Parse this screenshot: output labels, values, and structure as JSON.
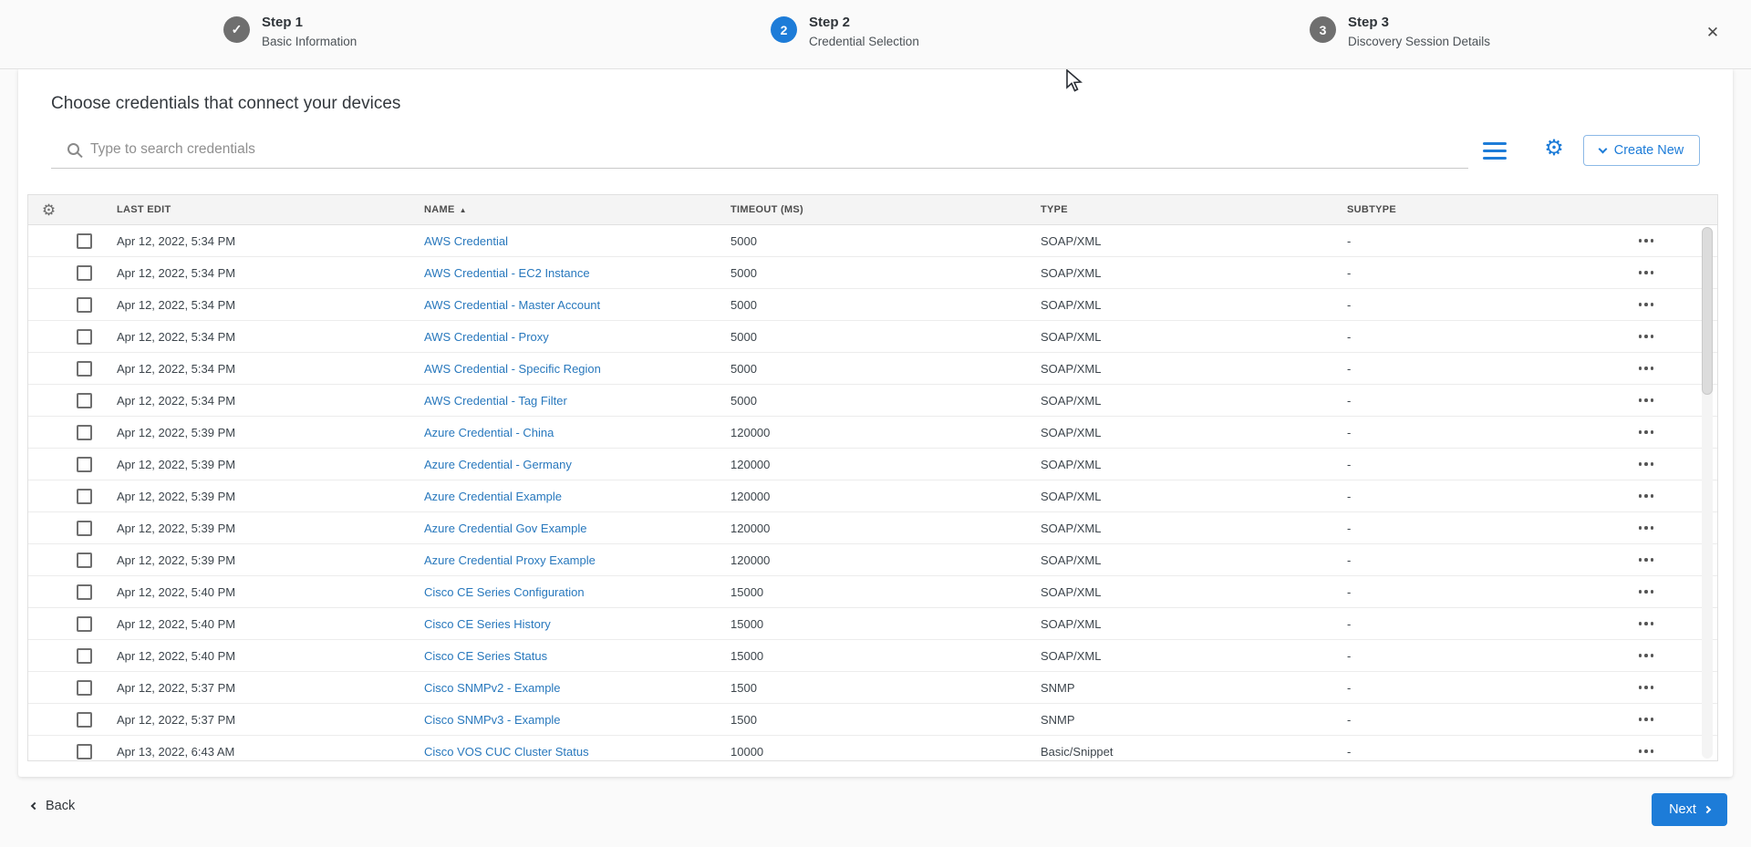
{
  "colors": {
    "accent_blue": "#1d7cd8",
    "link_blue": "#2878bd",
    "step_gray": "#6f6f6f"
  },
  "stepper": {
    "steps": [
      {
        "label": "Step 1",
        "sublabel": "Basic Information",
        "status": "complete",
        "marker": "✓"
      },
      {
        "label": "Step 2",
        "sublabel": "Credential Selection",
        "status": "active",
        "marker": "2"
      },
      {
        "label": "Step 3",
        "sublabel": "Discovery Session Details",
        "status": "upcoming",
        "marker": "3"
      }
    ],
    "close_icon": "✕"
  },
  "main": {
    "title": "Choose credentials that connect your devices",
    "search": {
      "placeholder": "Type to search credentials",
      "value": ""
    },
    "toolbar": {
      "gear_icon": "⚙",
      "create_new_label": "Create New"
    }
  },
  "table": {
    "header": {
      "gear_icon": "⚙",
      "last_edit": "LAST EDIT",
      "name": "NAME",
      "sort_arrow": "▲",
      "timeout": "TIMEOUT (MS)",
      "type": "TYPE",
      "subtype": "SUBTYPE"
    },
    "sort": {
      "column": "NAME",
      "direction": "asc"
    },
    "rows": [
      {
        "last_edit": "Apr 12, 2022, 5:34 PM",
        "name": "AWS Credential",
        "timeout": "5000",
        "type": "SOAP/XML",
        "subtype": "-"
      },
      {
        "last_edit": "Apr 12, 2022, 5:34 PM",
        "name": "AWS Credential - EC2 Instance",
        "timeout": "5000",
        "type": "SOAP/XML",
        "subtype": "-"
      },
      {
        "last_edit": "Apr 12, 2022, 5:34 PM",
        "name": "AWS Credential - Master Account",
        "timeout": "5000",
        "type": "SOAP/XML",
        "subtype": "-"
      },
      {
        "last_edit": "Apr 12, 2022, 5:34 PM",
        "name": "AWS Credential - Proxy",
        "timeout": "5000",
        "type": "SOAP/XML",
        "subtype": "-"
      },
      {
        "last_edit": "Apr 12, 2022, 5:34 PM",
        "name": "AWS Credential - Specific Region",
        "timeout": "5000",
        "type": "SOAP/XML",
        "subtype": "-"
      },
      {
        "last_edit": "Apr 12, 2022, 5:34 PM",
        "name": "AWS Credential - Tag Filter",
        "timeout": "5000",
        "type": "SOAP/XML",
        "subtype": "-"
      },
      {
        "last_edit": "Apr 12, 2022, 5:39 PM",
        "name": "Azure Credential - China",
        "timeout": "120000",
        "type": "SOAP/XML",
        "subtype": "-"
      },
      {
        "last_edit": "Apr 12, 2022, 5:39 PM",
        "name": "Azure Credential - Germany",
        "timeout": "120000",
        "type": "SOAP/XML",
        "subtype": "-"
      },
      {
        "last_edit": "Apr 12, 2022, 5:39 PM",
        "name": "Azure Credential Example",
        "timeout": "120000",
        "type": "SOAP/XML",
        "subtype": "-"
      },
      {
        "last_edit": "Apr 12, 2022, 5:39 PM",
        "name": "Azure Credential Gov Example",
        "timeout": "120000",
        "type": "SOAP/XML",
        "subtype": "-"
      },
      {
        "last_edit": "Apr 12, 2022, 5:39 PM",
        "name": "Azure Credential Proxy Example",
        "timeout": "120000",
        "type": "SOAP/XML",
        "subtype": "-"
      },
      {
        "last_edit": "Apr 12, 2022, 5:40 PM",
        "name": "Cisco CE Series Configuration",
        "timeout": "15000",
        "type": "SOAP/XML",
        "subtype": "-"
      },
      {
        "last_edit": "Apr 12, 2022, 5:40 PM",
        "name": "Cisco CE Series History",
        "timeout": "15000",
        "type": "SOAP/XML",
        "subtype": "-"
      },
      {
        "last_edit": "Apr 12, 2022, 5:40 PM",
        "name": "Cisco CE Series Status",
        "timeout": "15000",
        "type": "SOAP/XML",
        "subtype": "-"
      },
      {
        "last_edit": "Apr 12, 2022, 5:37 PM",
        "name": "Cisco SNMPv2 - Example",
        "timeout": "1500",
        "type": "SNMP",
        "subtype": "-"
      },
      {
        "last_edit": "Apr 12, 2022, 5:37 PM",
        "name": "Cisco SNMPv3 - Example",
        "timeout": "1500",
        "type": "SNMP",
        "subtype": "-"
      },
      {
        "last_edit": "Apr 13, 2022, 6:43 AM",
        "name": "Cisco VOS CUC Cluster Status",
        "timeout": "10000",
        "type": "Basic/Snippet",
        "subtype": "-"
      }
    ]
  },
  "footer": {
    "back_label": "Back",
    "next_label": "Next"
  }
}
